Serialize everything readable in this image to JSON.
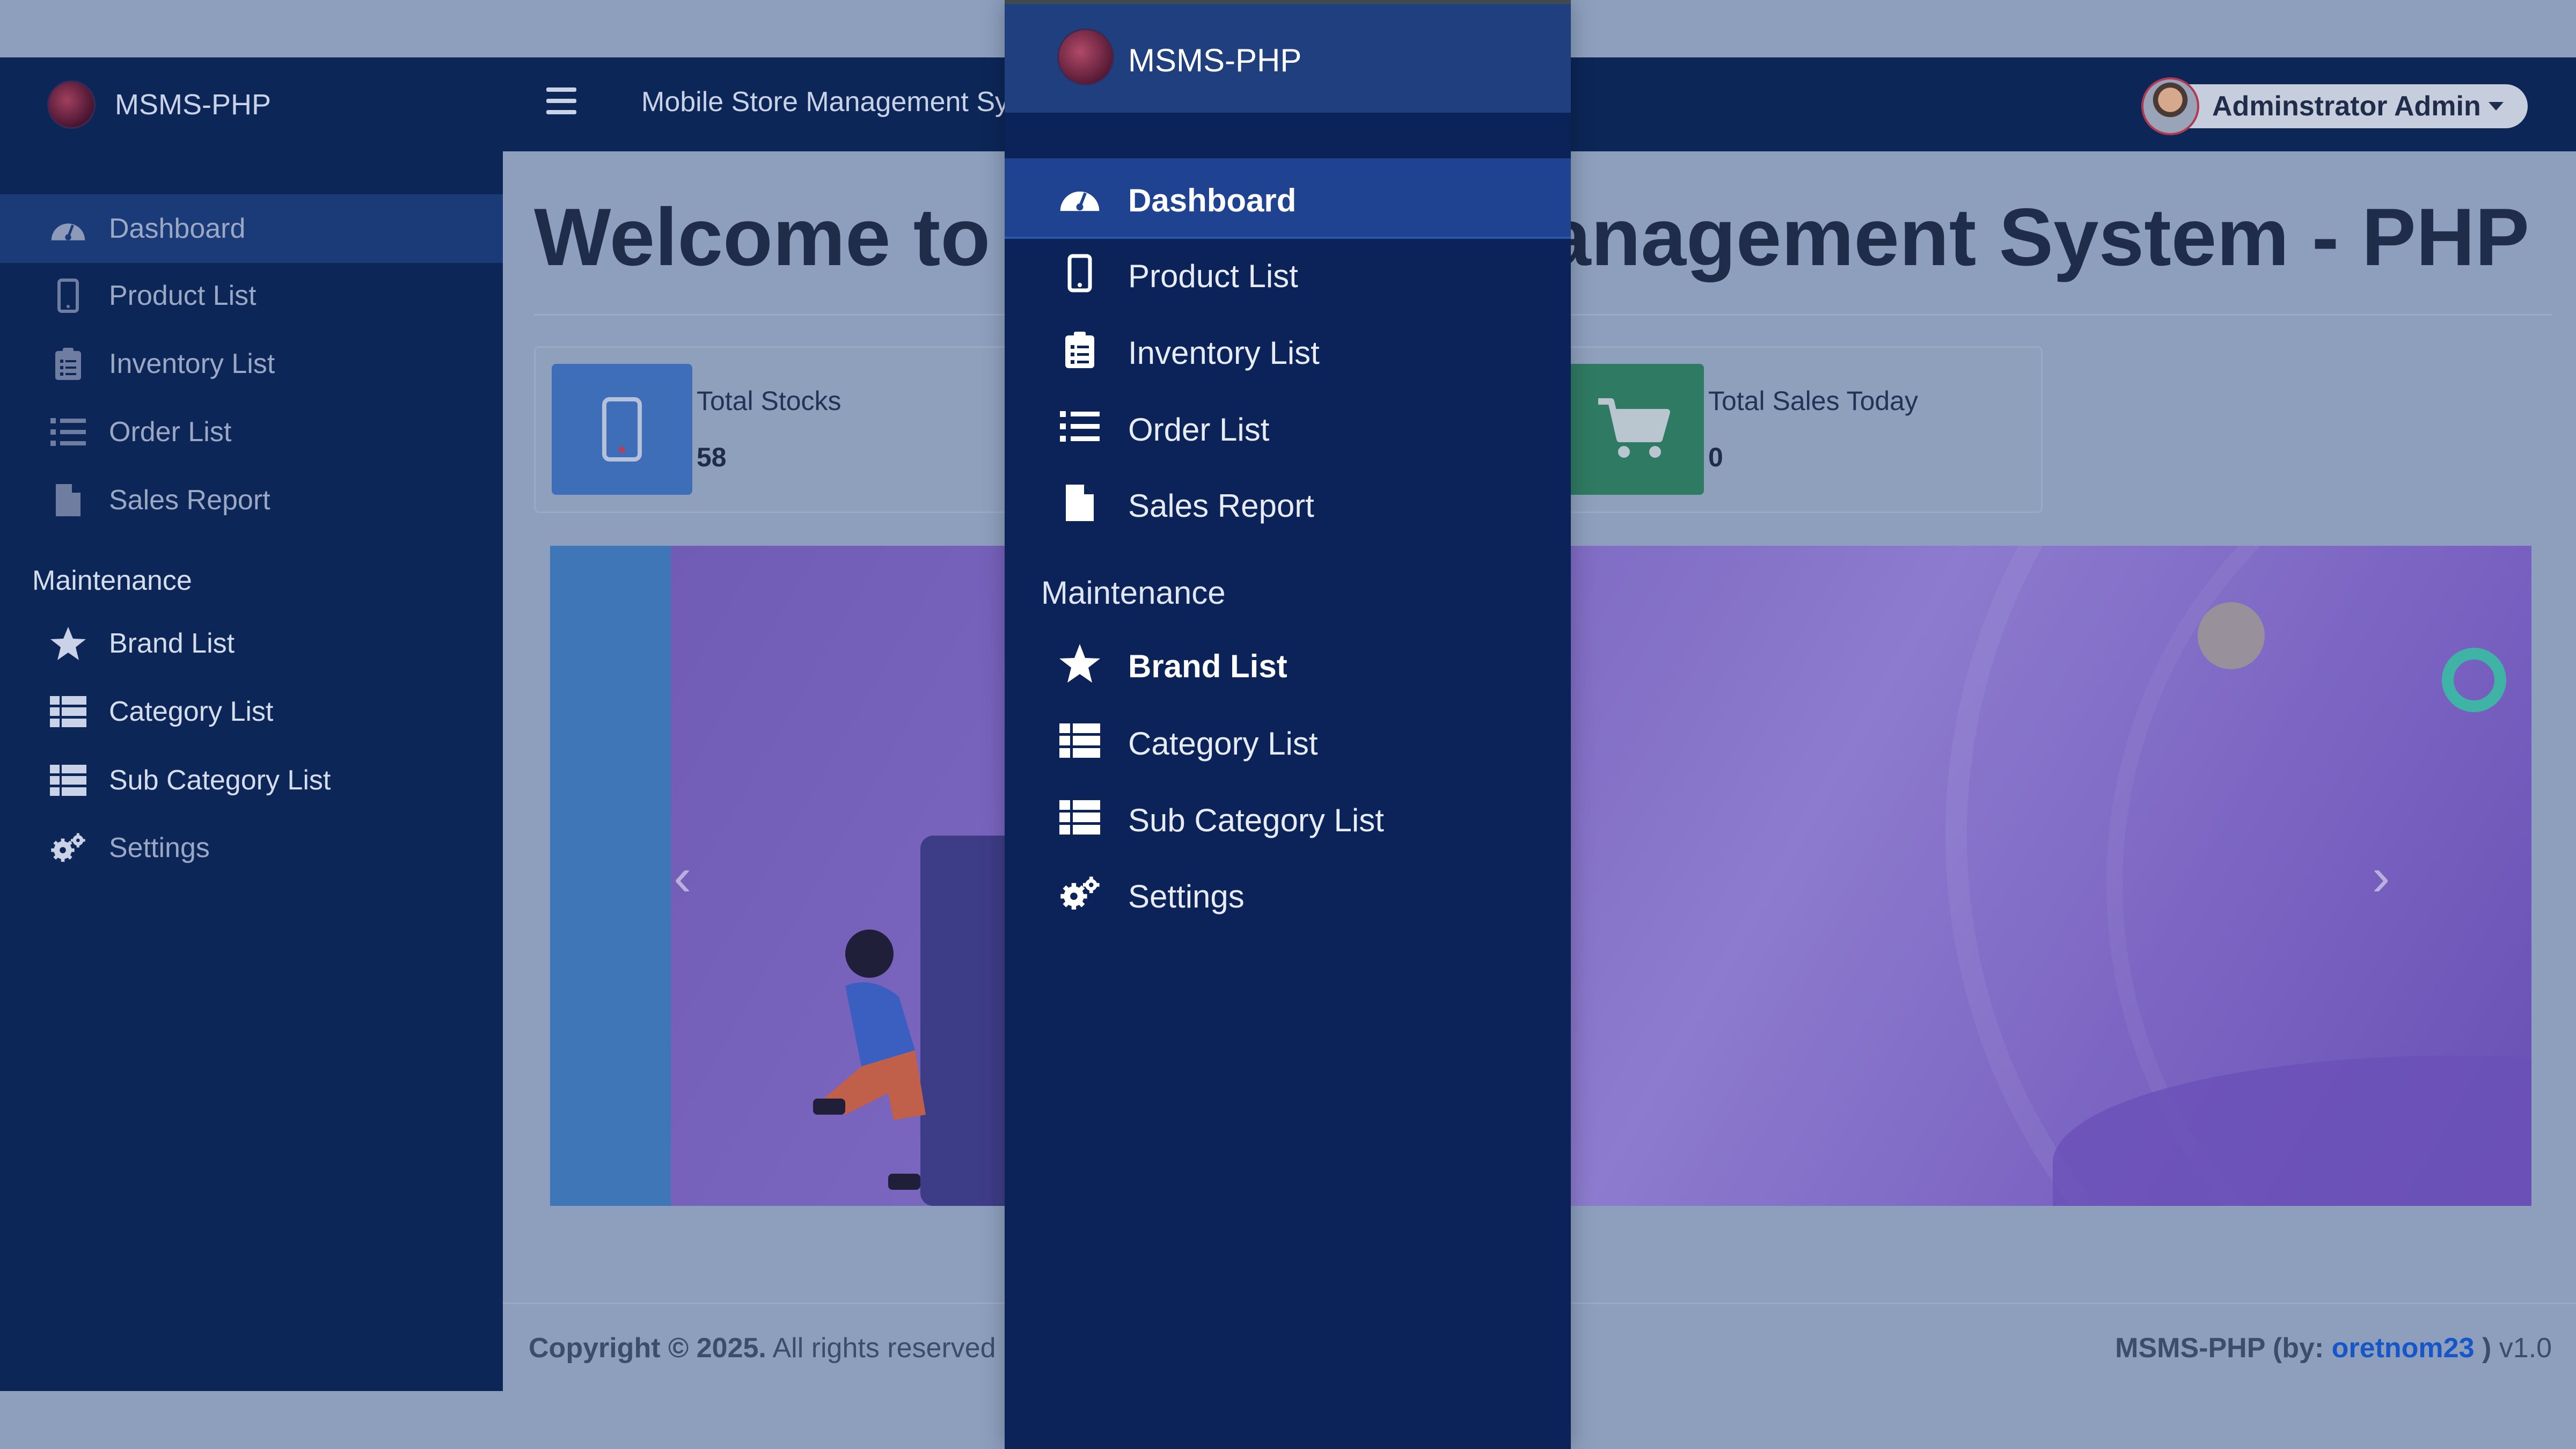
{
  "colors": {
    "topbar": "#0c2657",
    "sidebar": "#0c2657",
    "sidebar_active": "#1b3a78",
    "drawer": "#0b2358",
    "drawer_header": "#203f7e",
    "drawer_active": "#1f4390",
    "overlay_content": "#8d9fbd",
    "stock_icon_bg": "#3e6eb8",
    "sales_icon_bg": "#2f7a63",
    "link": "#1656c9"
  },
  "header": {
    "brand": "MSMS-PHP",
    "app_title": "Mobile Store Management Sy",
    "user_name": "Adminstrator Admin",
    "menu_icon": "hamburger-icon"
  },
  "sidebar": {
    "items": [
      {
        "label": "Dashboard",
        "icon": "dashboard-gauge-icon"
      },
      {
        "label": "Product List",
        "icon": "mobile-phone-icon"
      },
      {
        "label": "Inventory List",
        "icon": "clipboard-list-icon"
      },
      {
        "label": "Order List",
        "icon": "list-icon"
      },
      {
        "label": "Sales Report",
        "icon": "file-icon"
      }
    ],
    "section": "Maintenance",
    "maintenance_items": [
      {
        "label": "Brand List",
        "icon": "star-icon"
      },
      {
        "label": "Category List",
        "icon": "table-list-icon"
      },
      {
        "label": "Sub Category List",
        "icon": "table-list-icon"
      },
      {
        "label": "Settings",
        "icon": "cogs-icon"
      }
    ]
  },
  "main": {
    "welcome_left": "Welcome to",
    "welcome_right": "anagement System - PHP",
    "cards": [
      {
        "title": "Total Stocks",
        "value": "58",
        "icon": "mobile-phone-icon"
      },
      {
        "title": "Total Sales Today",
        "value": "0",
        "icon": "shopping-cart-icon"
      }
    ],
    "carousel": {
      "prev": "‹",
      "next": "›"
    }
  },
  "footer": {
    "copyright_bold": "Copyright © 2025.",
    "copyright_rest": " All rights reserved",
    "credit_prefix": "MSMS-PHP (by: ",
    "credit_author": "oretnom23",
    "credit_suffix": " )",
    "version": " v1.0"
  },
  "drawer": {
    "brand": "MSMS-PHP",
    "items": [
      {
        "label": "Dashboard",
        "icon": "dashboard-gauge-icon"
      },
      {
        "label": "Product List",
        "icon": "mobile-phone-icon"
      },
      {
        "label": "Inventory List",
        "icon": "clipboard-list-icon"
      },
      {
        "label": "Order List",
        "icon": "list-icon"
      },
      {
        "label": "Sales Report",
        "icon": "file-icon"
      }
    ],
    "section": "Maintenance",
    "maintenance_items": [
      {
        "label": "Brand List",
        "icon": "star-icon"
      },
      {
        "label": "Category List",
        "icon": "table-list-icon"
      },
      {
        "label": "Sub Category List",
        "icon": "table-list-icon"
      },
      {
        "label": "Settings",
        "icon": "cogs-icon"
      }
    ]
  }
}
